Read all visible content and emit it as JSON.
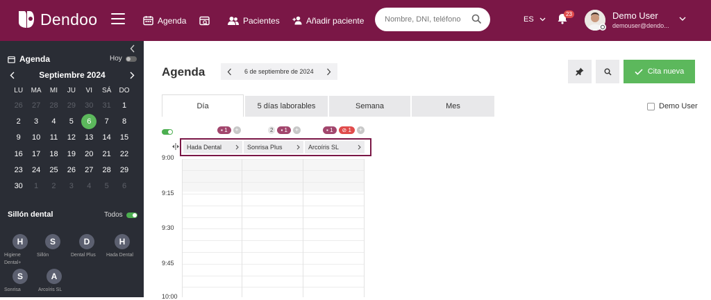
{
  "topbar": {
    "brand": "Dendoo",
    "nav": {
      "agenda": "Agenda",
      "pacientes": "Pacientes",
      "add_patient": "Añadir paciente"
    },
    "search_placeholder": "Nombre, DNI, teléfono",
    "lang": "ES",
    "notif_count": "23",
    "user_name": "Demo User",
    "user_email": "demouser@dendo..."
  },
  "sidebar": {
    "title": "Agenda",
    "today": "Hoy",
    "month": "Septiembre 2024",
    "weekdays": [
      "LU",
      "MA",
      "MI",
      "JU",
      "VI",
      "SÁ",
      "DO"
    ],
    "days": [
      [
        "26",
        "27",
        "28",
        "29",
        "30",
        "31",
        "1"
      ],
      [
        "2",
        "3",
        "4",
        "5",
        "6",
        "7",
        "8"
      ],
      [
        "9",
        "10",
        "11",
        "12",
        "13",
        "14",
        "15"
      ],
      [
        "16",
        "17",
        "18",
        "19",
        "20",
        "21",
        "22"
      ],
      [
        "23",
        "24",
        "25",
        "26",
        "27",
        "28",
        "29"
      ],
      [
        "30",
        "1",
        "2",
        "3",
        "4",
        "5",
        "6"
      ]
    ],
    "selected_day": "6",
    "chairs_title": "Sillón dental",
    "all": "Todos",
    "chairs": [
      {
        "initial": "H",
        "label": "Higiene Dental+"
      },
      {
        "initial": "S",
        "label": "Sillón"
      },
      {
        "initial": "D",
        "label": "Dental Plus"
      },
      {
        "initial": "H",
        "label": "Hada Dental"
      },
      {
        "initial": "S",
        "label": "Sonrisa"
      },
      {
        "initial": "A",
        "label": "Arcoíris SL"
      }
    ]
  },
  "main": {
    "title": "Agenda",
    "date": "6 de septiembre de 2024",
    "new_appointment": "Cita nueva",
    "tabs": [
      "Día",
      "5 días laborables",
      "Semana",
      "Mes"
    ],
    "active_tab": "Día",
    "demo_filter": "Demo User",
    "counters": [
      {
        "purple": "1",
        "gray": null,
        "red": null
      },
      {
        "purple": "1",
        "gray": "2",
        "red": null
      },
      {
        "purple": "1",
        "gray": null,
        "red": "1"
      }
    ],
    "columns": [
      "Hada Dental",
      "Sonrisa Plus",
      "Arcoíris SL"
    ],
    "times": [
      "9:00",
      "9:15",
      "9:30",
      "9:45",
      "10:00"
    ]
  },
  "colors": {
    "brand": "#7a1746",
    "sidebar": "#2a2d35",
    "accent_green": "#5cb85c",
    "pill_purple": "#a2466d",
    "pill_red": "#e04b4b"
  }
}
